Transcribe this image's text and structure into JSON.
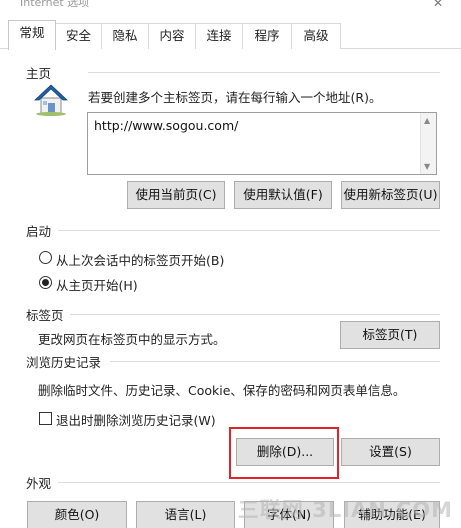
{
  "window": {
    "title": "Internet 选项",
    "close_glyph": "✕"
  },
  "tabs": [
    {
      "label": "常规",
      "active": true
    },
    {
      "label": "安全"
    },
    {
      "label": "隐私"
    },
    {
      "label": "内容"
    },
    {
      "label": "连接"
    },
    {
      "label": "程序"
    },
    {
      "label": "高级"
    }
  ],
  "home": {
    "group_label": "主页",
    "icon": "house-icon",
    "description": "若要创建多个主标签页，请在每行输入一个地址(R)。",
    "url_value": "http://www.sogou.com/",
    "btn_current": "使用当前页(C)",
    "btn_default": "使用默认值(F)",
    "btn_newtab": "使用新标签页(U)"
  },
  "startup": {
    "group_label": "启动",
    "option_last_session": "从上次会话中的标签页开始(B)",
    "option_home": "从主页开始(H)",
    "selected": "home"
  },
  "tabs_section": {
    "group_label": "标签页",
    "description": "更改网页在标签页中的显示方式。",
    "btn_tabs": "标签页(T)"
  },
  "history": {
    "group_label": "浏览历史记录",
    "description": "删除临时文件、历史记录、Cookie、保存的密码和网页表单信息。",
    "checkbox_label": "退出时删除浏览历史记录(W)",
    "checkbox_checked": false,
    "btn_delete": "删除(D)...",
    "btn_settings": "设置(S)"
  },
  "appearance": {
    "group_label": "外观",
    "btn_colors": "颜色(O)",
    "btn_languages": "语言(L)",
    "btn_fonts": "字体(N)",
    "btn_accessibility": "辅助功能(E)"
  },
  "watermark": "三联网 3LIAN.COM",
  "colors": {
    "highlight_border": "#e3232b",
    "button_bg": "#e1e1e1",
    "house_roof": "#1f5fa8"
  }
}
